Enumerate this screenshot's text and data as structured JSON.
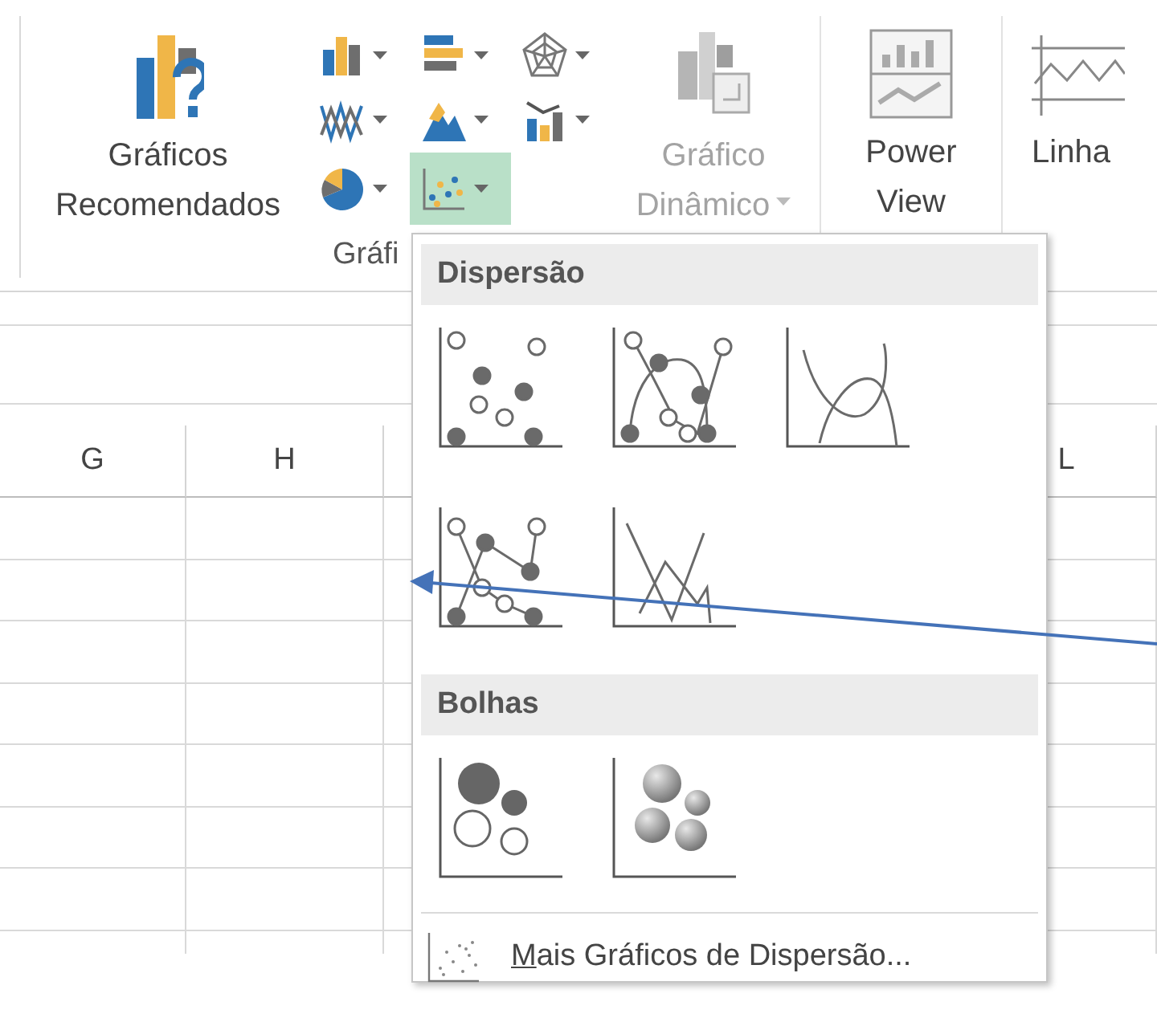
{
  "ribbon": {
    "recommended": {
      "label_lines": [
        "Gráficos",
        "Recomendados"
      ]
    },
    "chart_buttons": [
      {
        "kind": "column",
        "selected": false
      },
      {
        "kind": "bar",
        "selected": false
      },
      {
        "kind": "radar",
        "selected": false
      },
      {
        "kind": "line",
        "selected": false
      },
      {
        "kind": "area",
        "selected": false
      },
      {
        "kind": "combo",
        "selected": false
      },
      {
        "kind": "pie",
        "selected": false
      },
      {
        "kind": "scatter",
        "selected": true
      }
    ],
    "pivot_chart": {
      "label_lines": [
        "Gráfico",
        "Dinâmico"
      ],
      "disabled": true
    },
    "group_label": "Gráfi",
    "power_view": {
      "label_lines": [
        "Power",
        "View"
      ],
      "disabled": false
    },
    "sparkline": {
      "label": "Linha"
    }
  },
  "sheet": {
    "columns": [
      "G",
      "H",
      "L"
    ]
  },
  "scatter_menu": {
    "sections": [
      {
        "title": "Dispersão",
        "options": [
          {
            "kind": "markers"
          },
          {
            "kind": "smooth-markers"
          },
          {
            "kind": "smooth"
          },
          {
            "kind": "straight-markers"
          },
          {
            "kind": "straight"
          }
        ]
      },
      {
        "title": "Bolhas",
        "options": [
          {
            "kind": "bubble"
          },
          {
            "kind": "bubble-3d"
          }
        ]
      }
    ],
    "more_link": {
      "label": "Mais Gráficos de Dispersão...",
      "access_key_underlined": true
    }
  }
}
